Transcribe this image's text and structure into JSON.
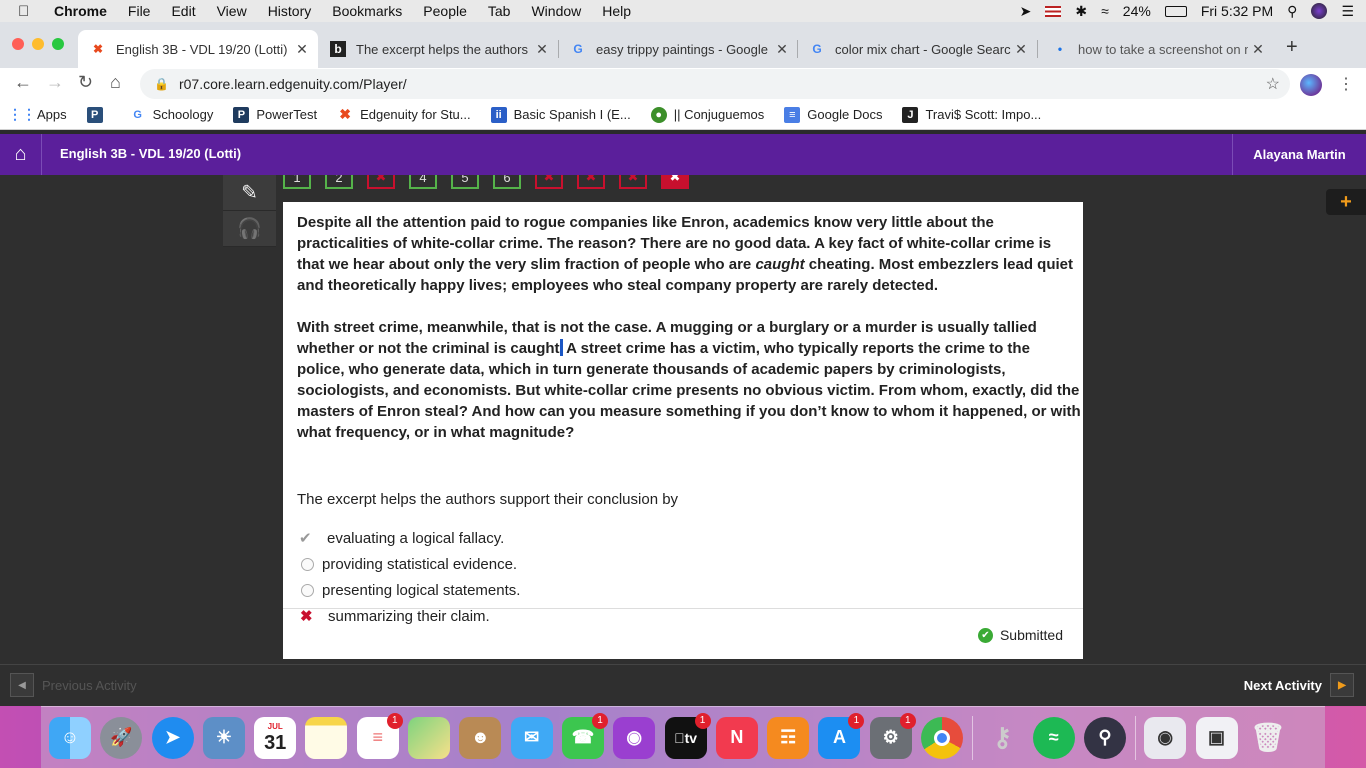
{
  "menubar": {
    "app": "Chrome",
    "items": [
      "File",
      "Edit",
      "View",
      "History",
      "Bookmarks",
      "People",
      "Tab",
      "Window",
      "Help"
    ],
    "battery": "24%",
    "clock": "Fri 5:32 PM"
  },
  "tabs": [
    {
      "title": "English 3B - VDL 19/20 (Lotti)",
      "icon": "edgenuity-icon",
      "color": "#e8491d"
    },
    {
      "title": "The excerpt helps the authors",
      "icon": "brainly-icon",
      "color": "#222222"
    },
    {
      "title": "easy trippy paintings - Google",
      "icon": "google-icon",
      "color": "#4285f4"
    },
    {
      "title": "color mix chart - Google Searc",
      "icon": "google-icon",
      "color": "#4285f4"
    },
    {
      "title": "how to take a screenshot on m",
      "icon": "page-icon",
      "color": "#1a73e8"
    }
  ],
  "toolbar": {
    "url": "r07.core.learn.edgenuity.com/Player/"
  },
  "bookmarks": [
    {
      "label": "Apps",
      "icon": "apps-grid-icon",
      "color": "#4285f4"
    },
    {
      "label": "",
      "icon": "powertest-icon",
      "color": "#2a4f7a"
    },
    {
      "label": "Schoology",
      "icon": "google-icon",
      "color": "#4285f4"
    },
    {
      "label": "PowerTest",
      "icon": "powertest-icon",
      "color": "#1f3b5e"
    },
    {
      "label": "Edgenuity for Stu...",
      "icon": "edgenuity-icon",
      "color": "#e8491d"
    },
    {
      "label": "Basic Spanish I (E...",
      "icon": "basic-spanish-icon",
      "color": "#2b5fc7"
    },
    {
      "label": "|| Conjuguemos",
      "icon": "frog-icon",
      "color": "#3c8f2a"
    },
    {
      "label": "Google Docs",
      "icon": "docs-icon",
      "color": "#4a7ee5"
    },
    {
      "label": "Travi$ Scott: Impo...",
      "icon": "jstor-icon",
      "color": "#222222"
    }
  ],
  "appbar": {
    "course": "English 3B - VDL 19/20 (Lotti)",
    "user": "Alayana Martin"
  },
  "questions": [
    {
      "label": "1",
      "state": "correct"
    },
    {
      "label": "2",
      "state": "correct"
    },
    {
      "label": "✖",
      "state": "wrong"
    },
    {
      "label": "4",
      "state": "correct"
    },
    {
      "label": "5",
      "state": "correct"
    },
    {
      "label": "6",
      "state": "correct"
    },
    {
      "label": "✖",
      "state": "wrong"
    },
    {
      "label": "✖",
      "state": "wrong"
    },
    {
      "label": "✖",
      "state": "wrong"
    },
    {
      "label": "✖",
      "state": "current"
    }
  ],
  "passage": {
    "p1_a": "Despite all the attention paid to rogue companies like Enron, academics know very little about the practicalities of white-collar crime. The reason? There are no good data. A key fact of white-collar crime is that we hear about only the very slim fraction of people who are ",
    "p1_em": "caught",
    "p1_b": " cheating. Most embezzlers lead quiet and theoretically happy lives; employees who steal company property are rarely detected.",
    "p2_a": "With street crime, meanwhile, that is not the case. A mugging or a burglary or a murder is usually tallied whether or not the criminal is caught",
    "p2_b": " A street crime has a victim, who typically reports the crime to the police, who generate data, which in turn generate thousands of academic papers by criminologists, sociologists, and economists. But white-collar crime presents no obvious victim. From whom, exactly, did the masters of Enron steal? And how can you measure something if you don’t know to whom it happened, or with what frequency, or in what magnitude?"
  },
  "question_text": "The excerpt helps the authors support their conclusion by",
  "options": [
    {
      "label": "evaluating a logical fallacy.",
      "state": "correct-answer"
    },
    {
      "label": "providing statistical evidence.",
      "state": "unselected"
    },
    {
      "label": "presenting logical statements.",
      "state": "unselected"
    },
    {
      "label": "summarizing their claim.",
      "state": "selected-wrong"
    }
  ],
  "status": "Submitted",
  "nav": {
    "prev": "Previous Activity",
    "next": "Next Activity"
  },
  "dock": {
    "calendar_month": "JUL",
    "calendar_day": "31",
    "apple_tv_label": "tv",
    "badge": "1"
  }
}
